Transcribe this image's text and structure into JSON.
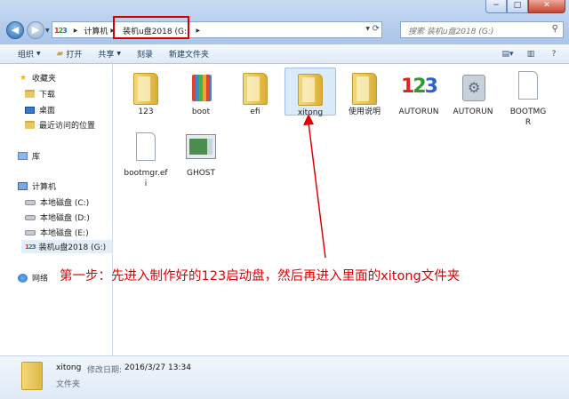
{
  "window": {
    "controls": [
      "−",
      "□",
      "✕"
    ]
  },
  "address": {
    "crumbs": [
      "计算机",
      "装机u盘2018 (G:)"
    ]
  },
  "search": {
    "placeholder": "搜索 装机u盘2018 (G:)"
  },
  "toolbar": {
    "organize": "组织",
    "open": "打开",
    "share": "共享",
    "burn": "刻录",
    "new_folder": "新建文件夹"
  },
  "sidebar": {
    "favorites": "收藏夹",
    "downloads": "下载",
    "desktop": "桌面",
    "recent": "最近访问的位置",
    "libraries": "库",
    "computer": "计算机",
    "drive_c": "本地磁盘 (C:)",
    "drive_d": "本地磁盘 (D:)",
    "drive_e": "本地磁盘 (E:)",
    "drive_g": "装机u盘2018 (G:)",
    "network": "网络"
  },
  "files": [
    {
      "name": "123",
      "kind": "folder"
    },
    {
      "name": "boot",
      "kind": "folder-books"
    },
    {
      "name": "efi",
      "kind": "folder"
    },
    {
      "name": "xitong",
      "kind": "folder",
      "selected": true
    },
    {
      "name": "使用说明",
      "kind": "folder"
    },
    {
      "name": "AUTORUN",
      "kind": "123-icon"
    },
    {
      "name": "AUTORUN",
      "kind": "settings-file"
    },
    {
      "name": "BOOTMGR",
      "kind": "blank-file"
    },
    {
      "name": "bootmgr.efi",
      "kind": "blank-file"
    },
    {
      "name": "GHOST",
      "kind": "ghost-exe"
    }
  ],
  "annotation": "第一步：先进入制作好的123启动盘，然后再进入里面的xitong文件夹",
  "details": {
    "name": "xitong",
    "modified_label": "修改日期:",
    "modified": "2016/3/27 13:34",
    "type": "文件夹"
  },
  "colors": {
    "annotation": "#e00000",
    "selection": "#dbeaf9"
  }
}
